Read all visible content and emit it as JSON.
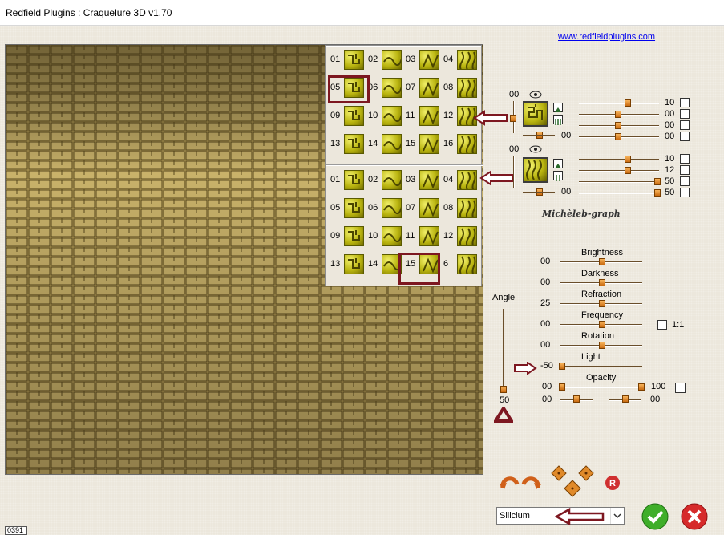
{
  "window": {
    "title": "Redfield Plugins : Craquelure 3D  v1.70"
  },
  "link": "www.redfieldplugins.com",
  "status_text": "0391",
  "patterns_top": [
    "01",
    "02",
    "03",
    "04",
    "05",
    "06",
    "07",
    "08",
    "09",
    "10",
    "11",
    "12",
    "13",
    "14",
    "15",
    "16"
  ],
  "patterns_bottom": [
    "01",
    "02",
    "03",
    "04",
    "05",
    "06",
    "07",
    "08",
    "09",
    "10",
    "11",
    "12",
    "13",
    "14",
    "15",
    "6"
  ],
  "selected_top": "05",
  "selected_bottom": "15",
  "layer1": {
    "visible_label": "00",
    "values": [
      "10",
      "00",
      "00",
      "00"
    ],
    "left_value": "00"
  },
  "layer2": {
    "visible_label": "00",
    "values": [
      "10",
      "12",
      "50",
      "50"
    ],
    "left_value": "00"
  },
  "signature": "Michèleb-graph",
  "params": [
    {
      "label": "Brightness",
      "value": "00",
      "level": 0.5
    },
    {
      "label": "Darkness",
      "value": "00",
      "level": 0.5
    },
    {
      "label": "Refraction",
      "value": "25",
      "level": 0.5
    },
    {
      "label": "Frequency",
      "value": "00",
      "level": 0.5
    },
    {
      "label": "Rotation",
      "value": "00",
      "level": 0.5
    },
    {
      "label": "Light",
      "value": "-50",
      "level": 0.0
    },
    {
      "label": "Opacity",
      "value": "00",
      "value_right": "100"
    }
  ],
  "frequency_ratio": "1:1",
  "extra_row": [
    "00",
    "00"
  ],
  "angle": {
    "label": "Angle",
    "value": "50"
  },
  "preset": {
    "selected": "Silicium"
  },
  "colors": {
    "accent_red": "#7d1720",
    "knob": "#e0892a",
    "ok": "#3fae2a",
    "cancel": "#d62a2a"
  }
}
